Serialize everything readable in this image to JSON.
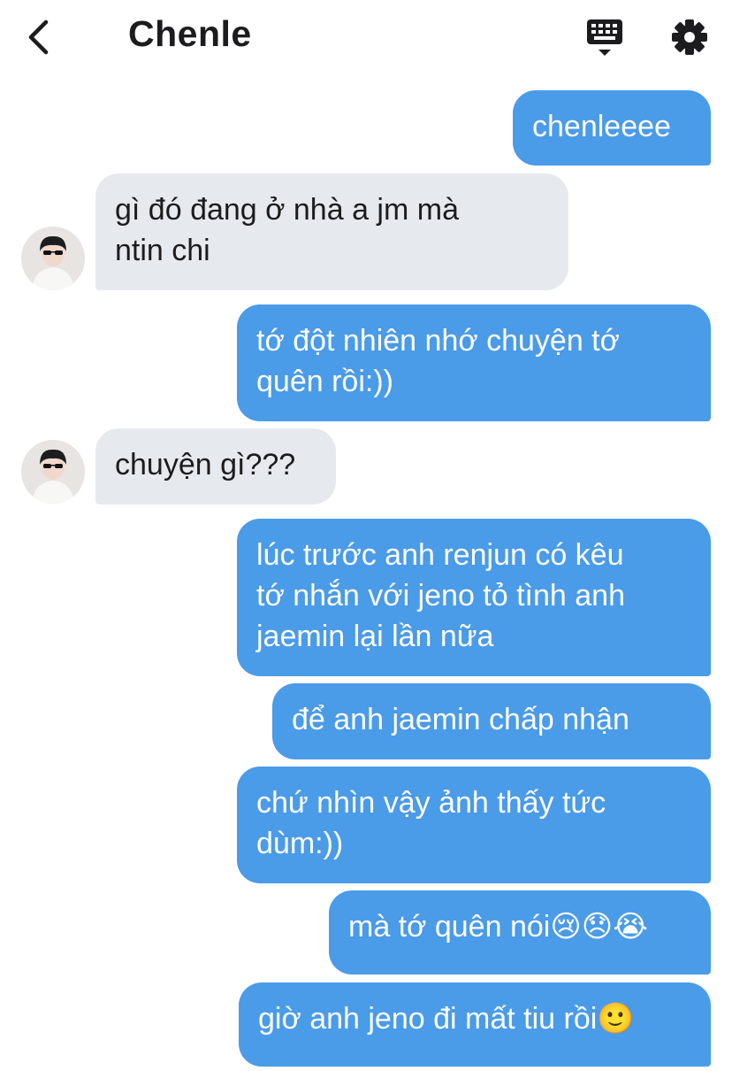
{
  "header": {
    "title": "Chenle",
    "back_icon": "chevron-left-icon",
    "keyboard_icon": "keyboard-icon",
    "settings_icon": "gear-icon"
  },
  "colors": {
    "outgoing_bubble": "#4a9be8",
    "incoming_bubble": "#e6eaee",
    "text_dark": "#1c1c1e"
  },
  "messages": [
    {
      "side": "out",
      "text": "chenleeee"
    },
    {
      "side": "in",
      "text": "gì đó đang ở nhà a jm mà\nntin chi"
    },
    {
      "side": "out",
      "text": "tớ đột nhiên nhớ chuyện tớ\nquên rồi:))"
    },
    {
      "side": "in",
      "text": "chuyện gì???"
    },
    {
      "side": "out",
      "text": "lúc trước anh renjun có kêu\ntớ nhắn với jeno tỏ tình anh\njaemin lại lần nữa"
    },
    {
      "side": "out",
      "text": "để anh jaemin chấp nhận"
    },
    {
      "side": "out",
      "text": "chứ nhìn vậy ảnh thấy tức\ndùm:))"
    },
    {
      "side": "out",
      "text": "mà tớ quên nói😢😞😭"
    },
    {
      "side": "out",
      "text": "giờ anh jeno đi mất tiu rồi🙂"
    }
  ]
}
